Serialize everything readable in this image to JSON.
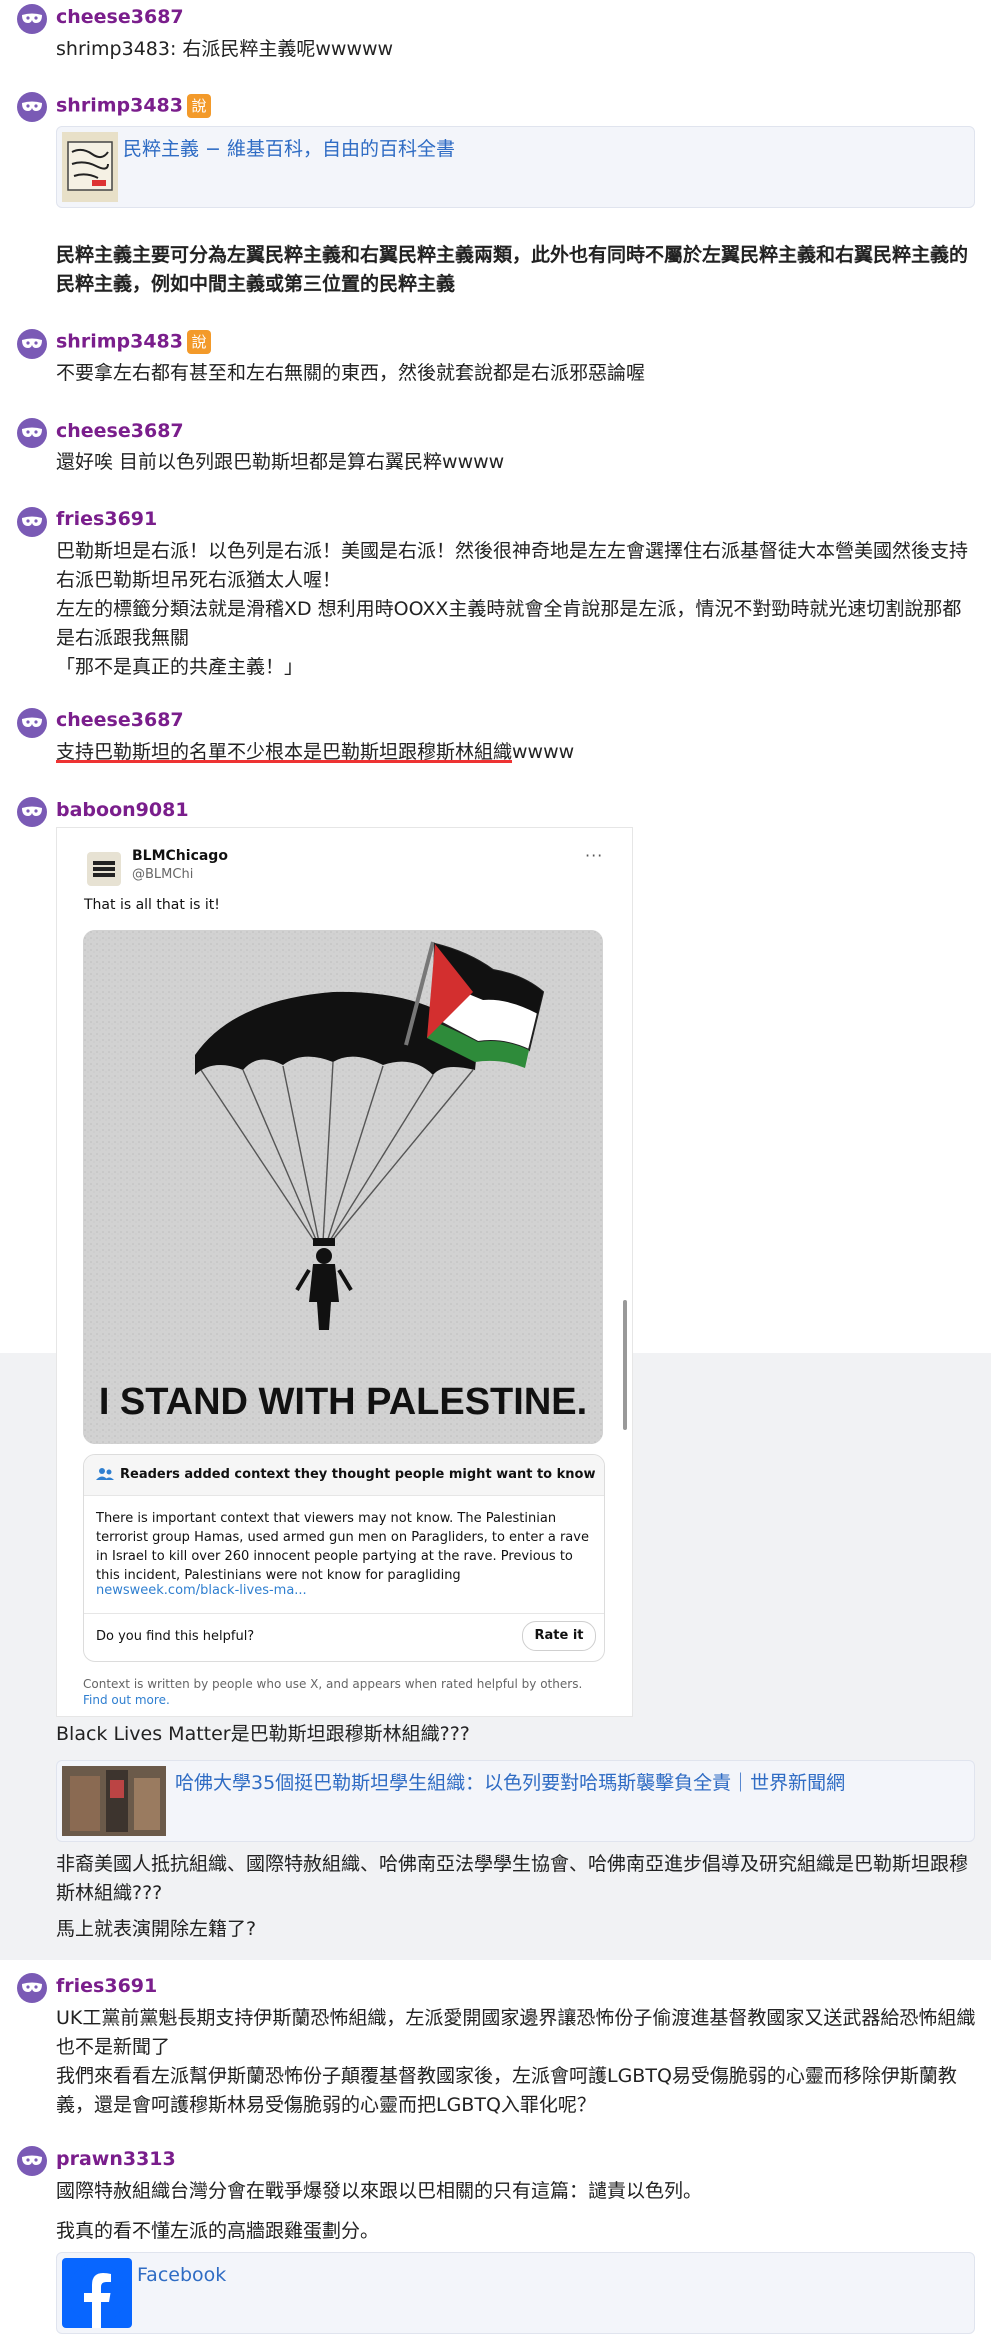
{
  "posts": [
    {
      "user": "cheese3687",
      "text": "shrimp3483: 右派民粹主義呢wwwww"
    },
    {
      "user": "shrimp3483",
      "badge": "說",
      "link": {
        "title": "民粹主義 − 維基百科，自由的百科全書"
      },
      "text": "民粹主義主要可分為左翼民粹主義和右翼民粹主義兩類，此外也有同時不屬於左翼民粹主義和右翼民粹主義的民粹主義，例如中間主義或第三位置的民粹主義"
    },
    {
      "user": "shrimp3483",
      "badge": "說",
      "text": "不要拿左右都有甚至和左右無關的東西，然後就套說都是右派邪惡論喔"
    },
    {
      "user": "cheese3687",
      "text": "還好唉 目前以色列跟巴勒斯坦都是算右翼民粹wwww"
    },
    {
      "user": "fries3691",
      "lines": [
        "巴勒斯坦是右派！以色列是右派！美國是右派！然後很神奇地是左左會選擇住右派基督徒大本營美國然後支持右派巴勒斯坦吊死右派猶太人喔！",
        "左左的標籤分類法就是滑稽XD 想利用時OOXX主義時就會全肯說那是左派，情況不對勁時就光速切割說那都是右派跟我無關",
        "「那不是真正的共產主義！」"
      ]
    },
    {
      "user": "cheese3687",
      "underlined": "支持巴勒斯坦的名單不少根本是巴勒斯坦跟穆斯林組織",
      "tail": "wwww"
    },
    {
      "user": "baboon9081",
      "tweet": {
        "name": "BLMChicago",
        "handle": "@BLMChi",
        "text": "That is all that is it!",
        "image_text": "I STAND WITH PALESTINE.",
        "context_title": "Readers added context they thought people might want to know",
        "context_body": "There is important context that viewers may not know. The Palestinian terrorist group Hamas, used armed gun men on Paragliders, to enter a rave in Israel to kill over 260 innocent people partying at the rave. Previous to this incident, Palestinians were not know for paragliding",
        "context_link": "newsweek.com/black-lives-ma...",
        "helpful": "Do you find this helpful?",
        "rate": "Rate it",
        "footer": "Context is written by people who use X, and appears when rated helpful by others.",
        "footer_link": "Find out more."
      },
      "text1": "Black Lives Matter是巴勒斯坦跟穆斯林組織???",
      "link": {
        "title": "哈佛大學35個挺巴勒斯坦學生組織：以色列要對哈瑪斯襲擊負全責｜世界新聞網"
      },
      "text2": "非裔美國人抵抗組織、國際特赦組織、哈佛南亞法學學生協會、哈佛南亞進步倡導及研究組織是巴勒斯坦跟穆斯林組織???",
      "text3": "馬上就表演開除左籍了?"
    },
    {
      "user": "fries3691",
      "lines": [
        "UK工黨前黨魁長期支持伊斯蘭恐怖組織，左派愛開國家邊界讓恐怖份子偷渡進基督教國家又送武器給恐怖組織也不是新聞了",
        "我們來看看左派幫伊斯蘭恐怖份子顛覆基督教國家後，左派會呵護LGBTQ易受傷脆弱的心靈而移除伊斯蘭教義，還是會呵護穆斯林易受傷脆弱的心靈而把LGBTQ入罪化呢？"
      ]
    },
    {
      "user": "prawn3313",
      "text1": "國際特赦組織台灣分會在戰爭爆發以來跟以巴相關的只有這篇：譴責以色列。",
      "text2": "我真的看不懂左派的高牆跟雞蛋劃分。",
      "link": {
        "title": "Facebook"
      }
    }
  ]
}
